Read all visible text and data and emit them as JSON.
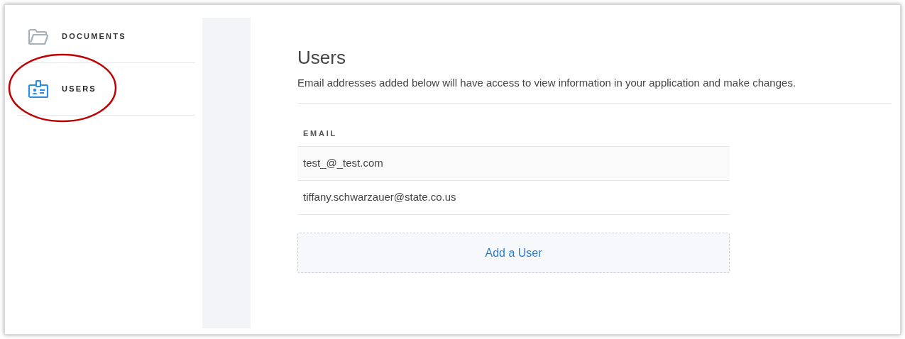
{
  "sidebar": {
    "items": [
      {
        "label": "DOCUMENTS",
        "kind": "folder",
        "selected": false
      },
      {
        "label": "USERS",
        "kind": "badge",
        "selected": true
      }
    ]
  },
  "annotation": {
    "kind": "ellipse",
    "color": "#c00000"
  },
  "main": {
    "title": "Users",
    "description": "Email addresses added below will have access to view information in your application and make changes.",
    "table": {
      "columns": [
        "EMAIL"
      ],
      "rows": [
        [
          "test_@_test.com"
        ],
        [
          "tiffany.schwarzauer@state.co.us"
        ]
      ]
    },
    "add_button": "Add a User"
  }
}
